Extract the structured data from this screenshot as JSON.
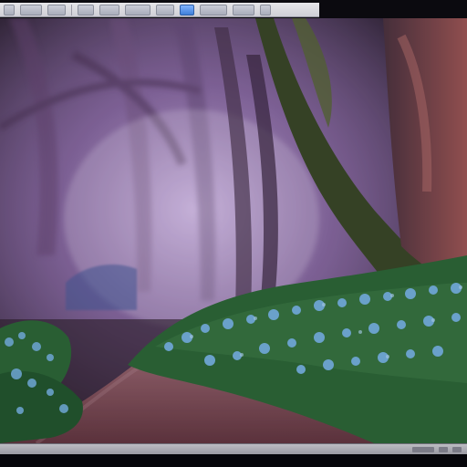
{
  "window": {
    "toolbar": {
      "buttons": [
        {
          "name": "file-menu-button"
        },
        {
          "name": "edit-menu-button"
        },
        {
          "name": "view-menu-button"
        },
        {
          "name": "image-menu-button"
        },
        {
          "name": "layer-menu-button"
        },
        {
          "name": "filters-menu-button"
        },
        {
          "name": "tools-menu-button"
        },
        {
          "name": "window-menu-button"
        },
        {
          "name": "help-menu-button"
        }
      ],
      "accent_color": "#3f7fd8"
    },
    "viewport": {
      "scene": "enchanted-forest-path",
      "palette": {
        "fog": "#b48bd6",
        "trees": "#5a3f58",
        "moss": "#2f6b3b",
        "flowers": "#79b8e6",
        "path": "#8b4f5d"
      }
    },
    "statusbar": {
      "colors": {
        "bg": "#9a9aa3"
      }
    }
  }
}
